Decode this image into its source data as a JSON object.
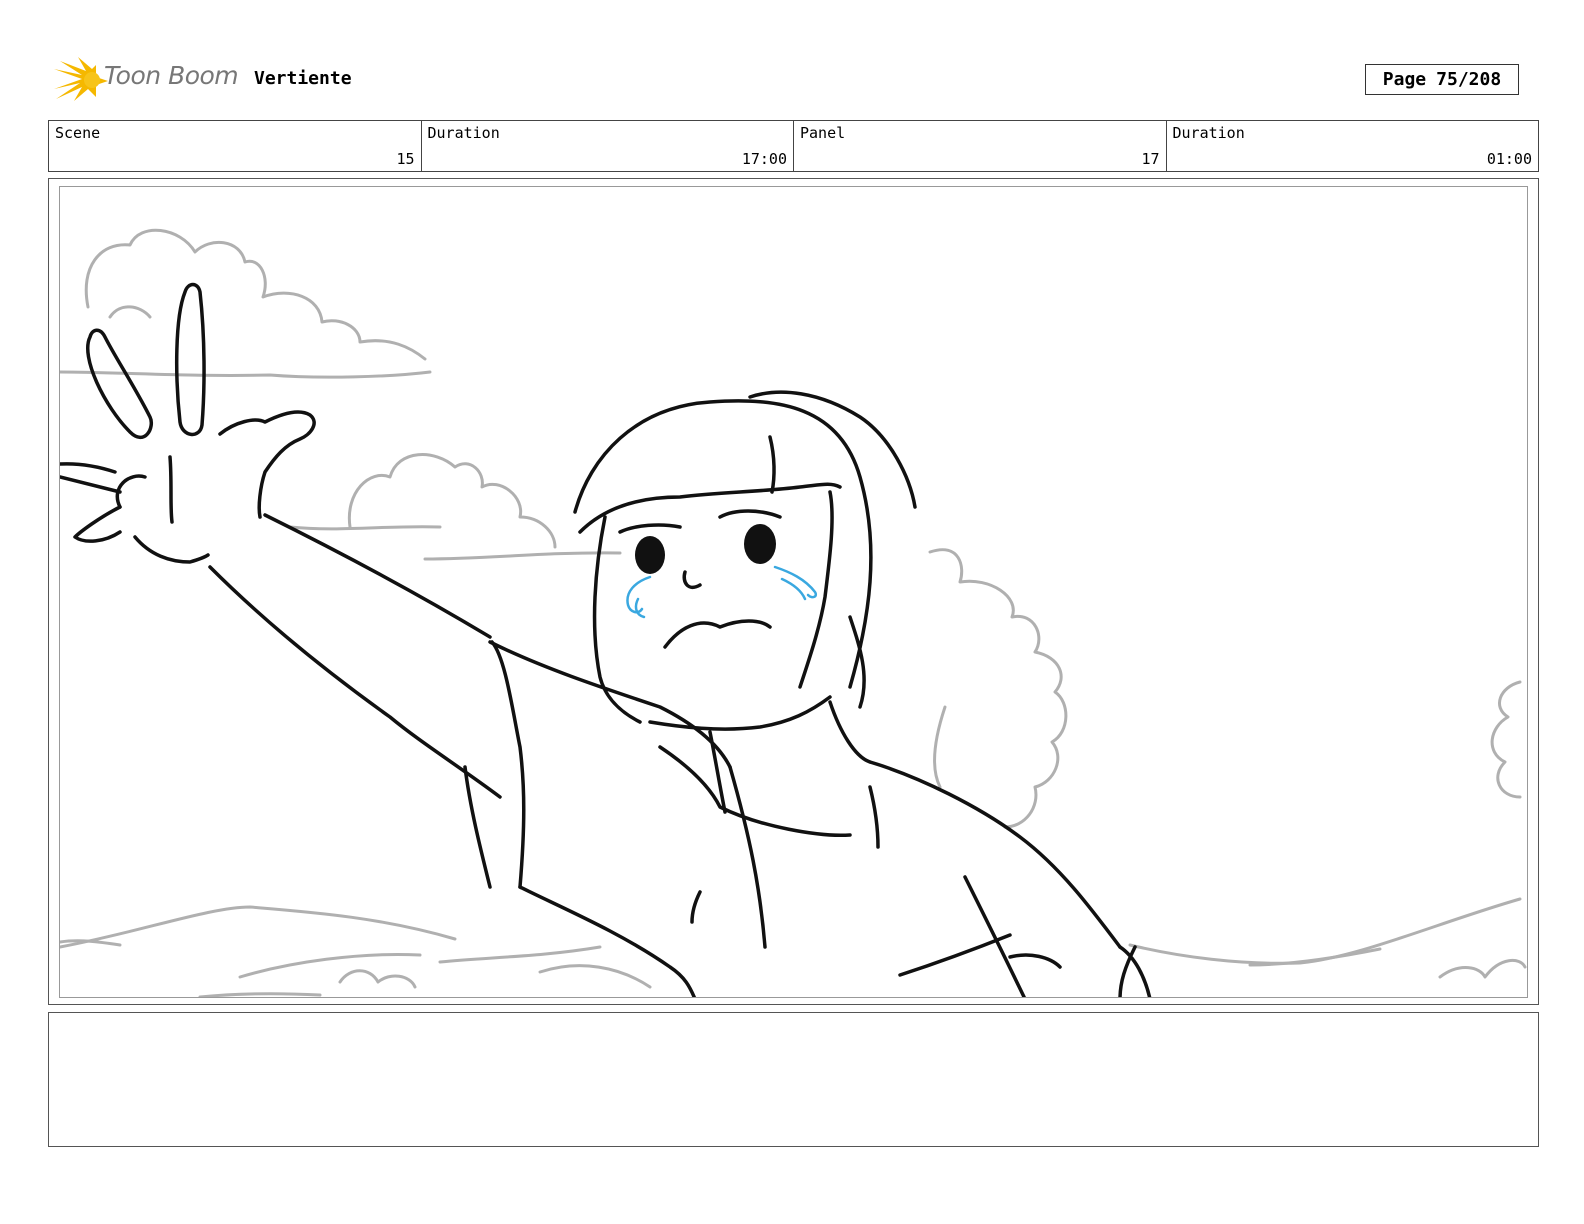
{
  "header": {
    "logo_text": "Toon Boom",
    "project_title": "Vertiente",
    "page_label": "Page",
    "page_number": "75/208"
  },
  "info": {
    "scene_label": "Scene",
    "scene_value": "15",
    "scene_duration_label": "Duration",
    "scene_duration_value": "17:00",
    "panel_label": "Panel",
    "panel_value": "17",
    "panel_duration_label": "Duration",
    "panel_duration_value": "01:00"
  },
  "colors": {
    "logo_star": "#f5b800",
    "logo_text": "#777777",
    "sketch_line": "#111111",
    "background_line": "#b0b0b0",
    "tears": "#3aa8e0"
  },
  "notes": {
    "text": ""
  }
}
